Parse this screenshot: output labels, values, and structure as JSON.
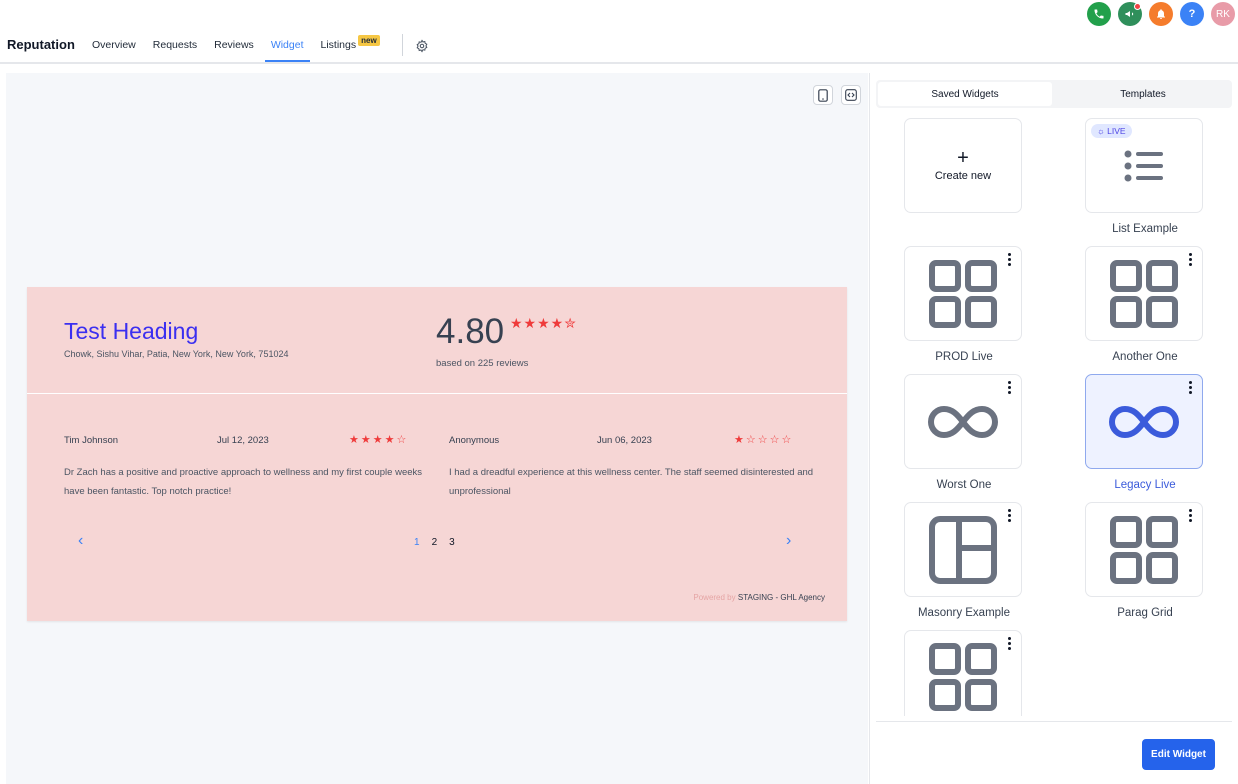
{
  "header": {
    "brand": "Reputation",
    "nav": [
      "Overview",
      "Requests",
      "Reviews",
      "Widget",
      "Listings"
    ],
    "active_nav": "Widget",
    "new_badge": "new",
    "avatar_initials": "RK",
    "help_glyph": "?"
  },
  "widget": {
    "title": "Test Heading",
    "address": "Chowk, Sishu Vihar, Patia, New York, New York, 751024",
    "rating": "4.80",
    "rating_stars": "★★★★✮",
    "based_on": "based on 225 reviews",
    "reviews": [
      {
        "name": "Tim Johnson",
        "date": "Jul 12, 2023",
        "stars": "★★★★☆",
        "text": "Dr Zach has a positive and proactive approach to wellness and my first couple weeks have been fantastic. Top notch practice!"
      },
      {
        "name": "Anonymous",
        "date": "Jun 06, 2023",
        "stars": "★☆☆☆☆",
        "text": "I had a dreadful experience at this wellness center. The staff seemed disinterested and unprofessional"
      }
    ],
    "pages": [
      "1",
      "2",
      "3"
    ],
    "powered_prefix": "Powered by",
    "powered_name": "STAGING - GHL Agency",
    "prev_glyph": "‹",
    "next_glyph": "›"
  },
  "panel": {
    "tabs": [
      "Saved Widgets",
      "Templates"
    ],
    "create_plus": "+",
    "create_label": "Create new",
    "live_badge": "☼ LIVE",
    "cards": [
      {
        "label": "List Example",
        "icon": "list-icon"
      },
      {
        "label": "PROD Live",
        "icon": "grid-icon"
      },
      {
        "label": "Another One",
        "icon": "grid-icon"
      },
      {
        "label": "Worst One",
        "icon": "infinity-icon"
      },
      {
        "label": "Legacy Live",
        "icon": "infinity-icon"
      },
      {
        "label": "Masonry Example",
        "icon": "masonry-icon"
      },
      {
        "label": "Parag Grid",
        "icon": "grid-icon"
      },
      {
        "label": "",
        "icon": "grid-icon"
      }
    ],
    "edit_button": "Edit Widget"
  },
  "colors": {
    "accent": "#3b82f6",
    "widget_bg": "#f6d6d5",
    "star_red": "#ef3b3b",
    "title_blue": "#3b2ff0",
    "button_blue": "#2563eb"
  }
}
